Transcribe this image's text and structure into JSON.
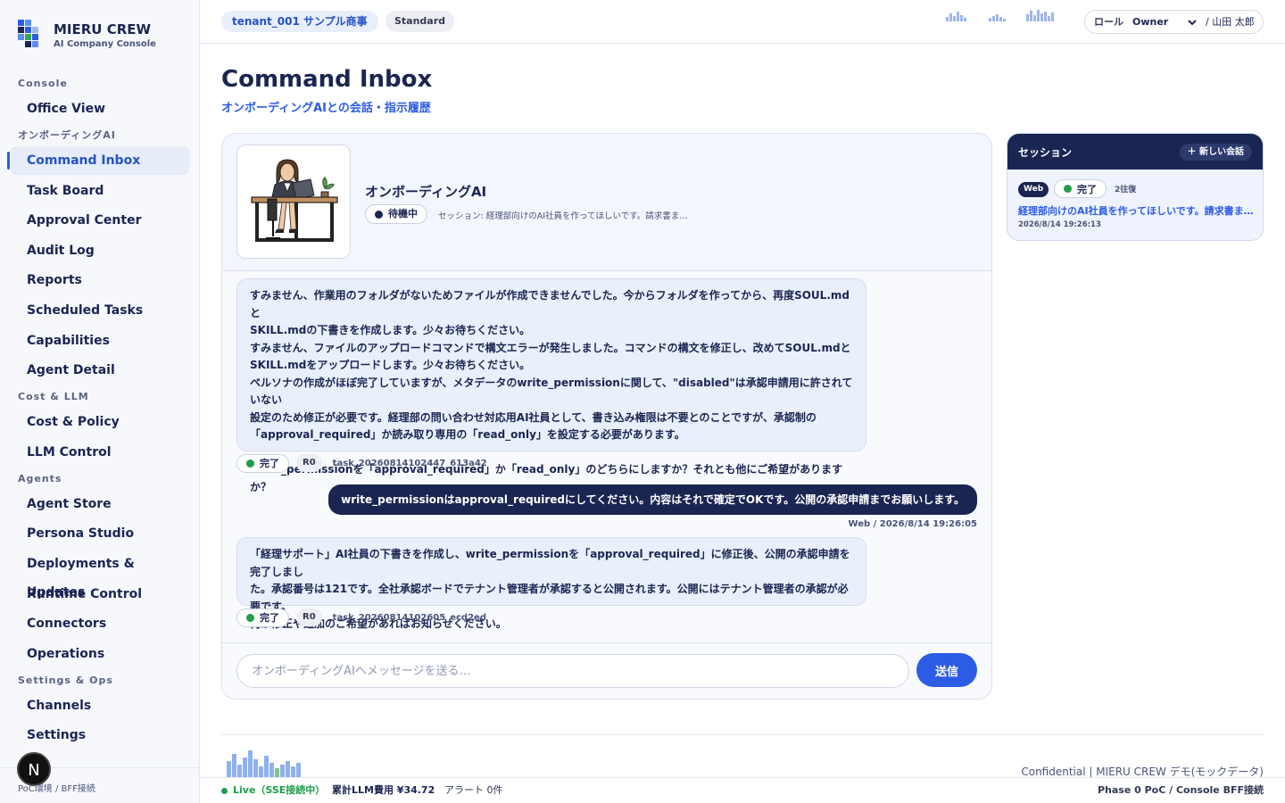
{
  "brand": {
    "title": "MIERU CREW",
    "subtitle": "AI Company Console"
  },
  "nav": {
    "groups": [
      {
        "label": "Console",
        "items": [
          {
            "label": "Office View"
          }
        ]
      },
      {
        "label": "オンボーディングAI",
        "items": [
          {
            "label": "Command Inbox",
            "active": true
          },
          {
            "label": "Task Board"
          },
          {
            "label": "Approval Center"
          },
          {
            "label": "Audit Log"
          },
          {
            "label": "Reports"
          },
          {
            "label": "Scheduled Tasks"
          },
          {
            "label": "Capabilities"
          },
          {
            "label": "Agent Detail"
          }
        ]
      },
      {
        "label": "Cost & LLM",
        "items": [
          {
            "label": "Cost & Policy"
          },
          {
            "label": "LLM Control"
          }
        ]
      },
      {
        "label": "Agents",
        "items": [
          {
            "label": "Agent Store"
          },
          {
            "label": "Persona Studio"
          },
          {
            "label": "Deployments & Updates"
          },
          {
            "label": "Runtime Control"
          },
          {
            "label": "Connectors"
          },
          {
            "label": "Operations"
          }
        ]
      },
      {
        "label": "Settings & Ops",
        "items": [
          {
            "label": "Channels"
          },
          {
            "label": "Settings"
          }
        ]
      }
    ],
    "footer": "PoC環境 / BFF接続",
    "avatar_letter": "N"
  },
  "topbar": {
    "tenant": "tenant_001 サンプル商事",
    "plan": "Standard",
    "role_label": "ロール",
    "role_value": "Owner",
    "user": "/ 山田 太郎"
  },
  "page": {
    "title": "Command Inbox",
    "subtitle": "オンボーディングAIとの会話・指示履歴"
  },
  "chat": {
    "agent_name": "オンボーディングAI",
    "status": "待機中",
    "session_line": "セッション: 経理部向けのAI社員を作ってほしいです。請求書ま…",
    "messages": [
      {
        "lines": [
          "すみません、作業用のフォルダがないためファイルが作成できませんでした。今からフォルダを作ってから、再度SOUL.mdと",
          "SKILL.mdの下書きを作成します。少々お待ちください。",
          "すみません、ファイルのアップロードコマンドで構文エラーが発生しました。コマンドの構文を修正し、改めてSOUL.mdと",
          "SKILL.mdをアップロードします。少々お待ちください。",
          "ペルソナの作成がほぼ完了していますが、メタデータのwrite_permissionに関して、\"disabled\"は承認申請用に許されていない",
          "設定のため修正が必要です。経理部の問い合わせ対応用AI社員として、書き込み権限は不要とのことですが、承認制の",
          "「approval_required」か読み取り専用の「read_only」を設定する必要があります。",
          "",
          "write_permissionを「approval_required」か「read_only」のどちらにしますか？それとも他にご希望がありますか？"
        ],
        "status": "完了",
        "badge": "R0",
        "task_id": "task_20260814102447_613a42"
      },
      {
        "lines": [
          "「経理サポート」AI社員の下書きを作成し、write_permissionを「approval_required」に修正後、公開の承認申請を完了しまし",
          "た。承認番号は121です。全社承認ボードでテナント管理者が承認すると公開されます。公開にはテナント管理者の承認が必要です。",
          "何か修正や追加のご希望があればお知らせください。"
        ],
        "status": "完了",
        "badge": "R0",
        "task_id": "task_20260814102605_ecd2ed"
      }
    ],
    "user_message": "write_permissionはapproval_requiredにしてください。内容はそれで確定でOKです。公開の承認申請までお願いします。",
    "user_meta": "Web / 2026/8/14 19:26:05",
    "input_placeholder": "オンボーディングAIへメッセージを送る…",
    "send_label": "送信"
  },
  "sessions": {
    "title": "セッション",
    "new_label": "＋ 新しい会話",
    "items": [
      {
        "channel": "Web",
        "status": "完了",
        "turns": "2往復",
        "text": "経理部向けのAI社員を作ってほしいです。請求書ま…",
        "time": "2026/8/14 19:26:13"
      }
    ]
  },
  "footer": {
    "confidential": "Confidential | MIERU CREW デモ(モックデータ)",
    "live": "Live（SSE接続中）",
    "cost": "累計LLM費用 ¥34.72",
    "alert": "アラート 0件",
    "phase": "Phase 0 PoC / Console BFF接続"
  },
  "colors": {
    "navy": "#1b2552",
    "accent": "#2c5ce6",
    "done_green": "#1f9d4c",
    "idle_navy": "#1b2552"
  }
}
